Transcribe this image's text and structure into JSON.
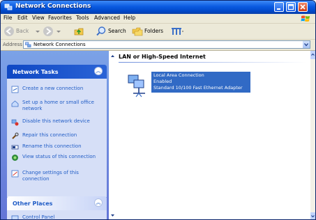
{
  "window": {
    "title": "Network Connections"
  },
  "menubar": {
    "items": [
      "File",
      "Edit",
      "View",
      "Favorites",
      "Tools",
      "Advanced",
      "Help"
    ]
  },
  "toolbar": {
    "back_label": "Back",
    "search_label": "Search",
    "folders_label": "Folders"
  },
  "addressbar": {
    "label": "Address",
    "value": "Network Connections"
  },
  "left_pane": {
    "network_tasks": {
      "title": "Network Tasks",
      "items": [
        {
          "label": "Create a new connection",
          "icon": "new-connection-icon"
        },
        {
          "label": "Set up a home or small office network",
          "icon": "home-network-icon"
        },
        {
          "label": "Disable this network device",
          "icon": "disable-device-icon"
        },
        {
          "label": "Repair this connection",
          "icon": "repair-icon"
        },
        {
          "label": "Rename this connection",
          "icon": "rename-icon"
        },
        {
          "label": "View status of this connection",
          "icon": "status-icon"
        },
        {
          "label": "Change settings of this connection",
          "icon": "settings-icon"
        }
      ]
    },
    "other_places": {
      "title": "Other Places",
      "items": [
        {
          "label": "Control Panel",
          "icon": "control-panel-icon"
        }
      ]
    }
  },
  "right_pane": {
    "group_header": "LAN or High-Speed Internet",
    "connection": {
      "name": "Local Area Connection",
      "status": "Enabled",
      "device": "Standard 10/100 Fast Ethernet Adapter"
    }
  },
  "colors": {
    "titlebar": "#0a5ae0",
    "task_panel_head": "#0f48c4",
    "selection": "#316ac5",
    "link": "#215dc6"
  }
}
